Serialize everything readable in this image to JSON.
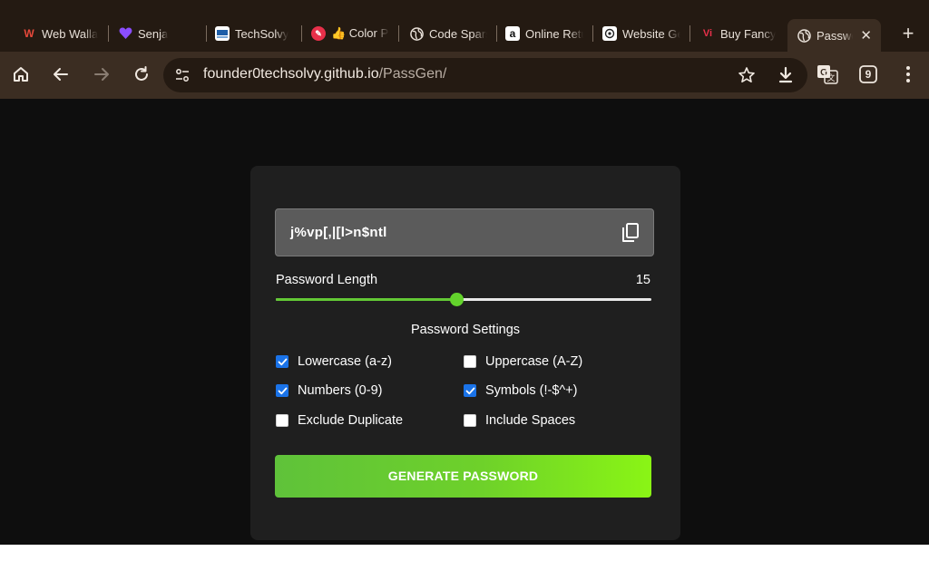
{
  "tabs": [
    {
      "title": "Web Walla",
      "favicon": "w-logo-icon",
      "color": "#e8493b"
    },
    {
      "title": "Senja",
      "favicon": "heart-icon",
      "color": "#8a4dff"
    },
    {
      "title": "TechSolvy",
      "favicon": "techsolvy-icon",
      "color": "#1d5ea8"
    },
    {
      "title": "👍 Color Pi",
      "favicon": "color-picker-icon",
      "color": "#e8304a"
    },
    {
      "title": "Code Spars",
      "favicon": "globe-icon",
      "color": "#e8e0d8"
    },
    {
      "title": "Online Retu",
      "favicon": "amazon-icon",
      "color": "#ffffff"
    },
    {
      "title": "Website Ge",
      "favicon": "openai-icon",
      "color": "#ffffff"
    },
    {
      "title": "Buy Fancy",
      "favicon": "vi-logo-icon",
      "color": "#e8304a"
    },
    {
      "title": "Passwor",
      "favicon": "globe-icon",
      "color": "#e8e0d8",
      "active": true
    }
  ],
  "toolbar": {
    "url_domain": "founder0techsolvy.github.io",
    "url_path": "/PassGen/",
    "extension_badge": "9"
  },
  "generator": {
    "password": "j%vp[,|[l>n$ntl",
    "length_label": "Password Length",
    "length_value": "15",
    "length_fraction": 0.48,
    "settings_title": "Password Settings",
    "options": {
      "lowercase": {
        "label": "Lowercase (a-z)",
        "checked": true
      },
      "uppercase": {
        "label": "Uppercase (A-Z)",
        "checked": false
      },
      "numbers": {
        "label": "Numbers (0-9)",
        "checked": true
      },
      "symbols": {
        "label": "Symbols (!-$^+)",
        "checked": true
      },
      "exclude_duplicate": {
        "label": "Exclude Duplicate",
        "checked": false
      },
      "include_spaces": {
        "label": "Include Spaces",
        "checked": false
      }
    },
    "generate_label": "GENERATE PASSWORD"
  },
  "colors": {
    "accent": "#63c935",
    "checkbox": "#1a73e8",
    "page_bg": "#0e0e0e",
    "card_bg": "#1f1f1f"
  }
}
